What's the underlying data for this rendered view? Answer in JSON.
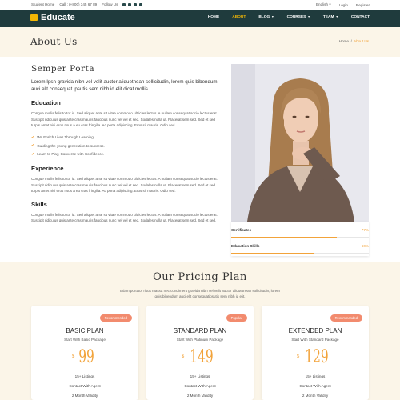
{
  "topbar": {
    "left_link": "Student Home",
    "phone": "Call : (+800) 345 67 89",
    "follow": "Follow Us",
    "social_icons": [
      "linkedin-icon",
      "instagram-icon",
      "twitter-icon",
      "facebook-icon"
    ],
    "language": "English",
    "login": "Login",
    "register": "Register"
  },
  "brand": {
    "name": "Educate",
    "color": "#f2b705"
  },
  "nav": {
    "home": "HOME",
    "about": "ABOUT",
    "blog": "BLOG",
    "courses": "COURSES",
    "team": "TEAM",
    "contact": "CONTACT"
  },
  "page_header": {
    "title": "About Us",
    "breadcrumb_home": "Home",
    "breadcrumb_sep": "/",
    "breadcrumb_current": "About Us"
  },
  "about": {
    "heading": "Semper Porta",
    "lead": "Lorem Ipsn gravida nibh vel velit auctor aliquetnean sollicitudin, lorem quis bibendum auci elit consequat ipsutis sem nibh id elit dicat mollis",
    "education_title": "Education",
    "education_text": "Congue mollis felis tortor id. Sed aliquet ante sit vitae commodo ultricies lectus. A nullam consequat socio lectus erat. Suscipit ridiculus quis ante cras mauris faucibus nunc vel vel et sed. Sodales nulla ut. Placerat sem sed. Sed et sed turpis amet nisi eros risus a eu cras fringilla. Ac porta adipiscing. Eros sit mauris. Odio sed.",
    "checks": [
      "We Enrich Lives Through Learning.",
      "Guiding the young generation to success.",
      "Learn to Play, Converse with Confidence."
    ],
    "experience_title": "Experience",
    "experience_text": "Congue mollis felis tortor id. Sed aliquet ante sit vitae commodo ultricies lectus. A nullam consequat socio lectus erat. Suscipit ridiculus quis ante cras mauris faucibus nunc vel vel et sed. Sodales nulla ut. Placerat sem sed. Sed et sed turpis amet nisi eros risus a eu cras fringilla. Ac porta adipiscing. Eros sit mauris. Odio sed.",
    "skills_title": "Skills",
    "skills_text": "Congue mollis felis tortor id. Sed aliquet ante sit vitae commodo ultricies lectus. A nullam consequat socio lectus erat. Suscipit ridiculus quis ante cras mauris faucibus nunc vel vel et sed. Sodales nulla ut. Placerat sem sed. Sed et sed."
  },
  "skills": [
    {
      "label": "Certificates",
      "value": "77%",
      "fraction": 0.77
    },
    {
      "label": "Education Skills",
      "value": "60%",
      "fraction": 0.6
    }
  ],
  "pricing": {
    "title": "Our Pricing Plan",
    "subtitle": "Etiam porttitor risus massa nec condiment gravida nibh vel velit auctor aliquetnean sollicitudin, lorem quis bibendum auci elit consequatipsutis sem nibh id elit.",
    "plans": [
      {
        "badge": "Recommended",
        "name": "BASIC PLAN",
        "desc": "Start With Basic Package",
        "currency": "$",
        "price": "99",
        "features": [
          "15+ Listings",
          "Contact With Agent",
          "2 Month Validity"
        ]
      },
      {
        "badge": "Popular",
        "name": "STANDARD PLAN",
        "desc": "Start With Platinum Package",
        "currency": "$",
        "price": "149",
        "features": [
          "15+ Listings",
          "Contact With Agent",
          "2 Month Validity"
        ]
      },
      {
        "badge": "Recommended",
        "name": "EXTENDED PLAN",
        "desc": "Start With Standard Package",
        "currency": "$",
        "price": "129",
        "features": [
          "15+ Listings",
          "Contact With Agent",
          "2 Month Validity"
        ]
      }
    ]
  },
  "colors": {
    "accent": "#f2a33a",
    "nav_bg": "#1f3b3d",
    "cream": "#fbf5e8",
    "badge": "#f28b6e"
  }
}
